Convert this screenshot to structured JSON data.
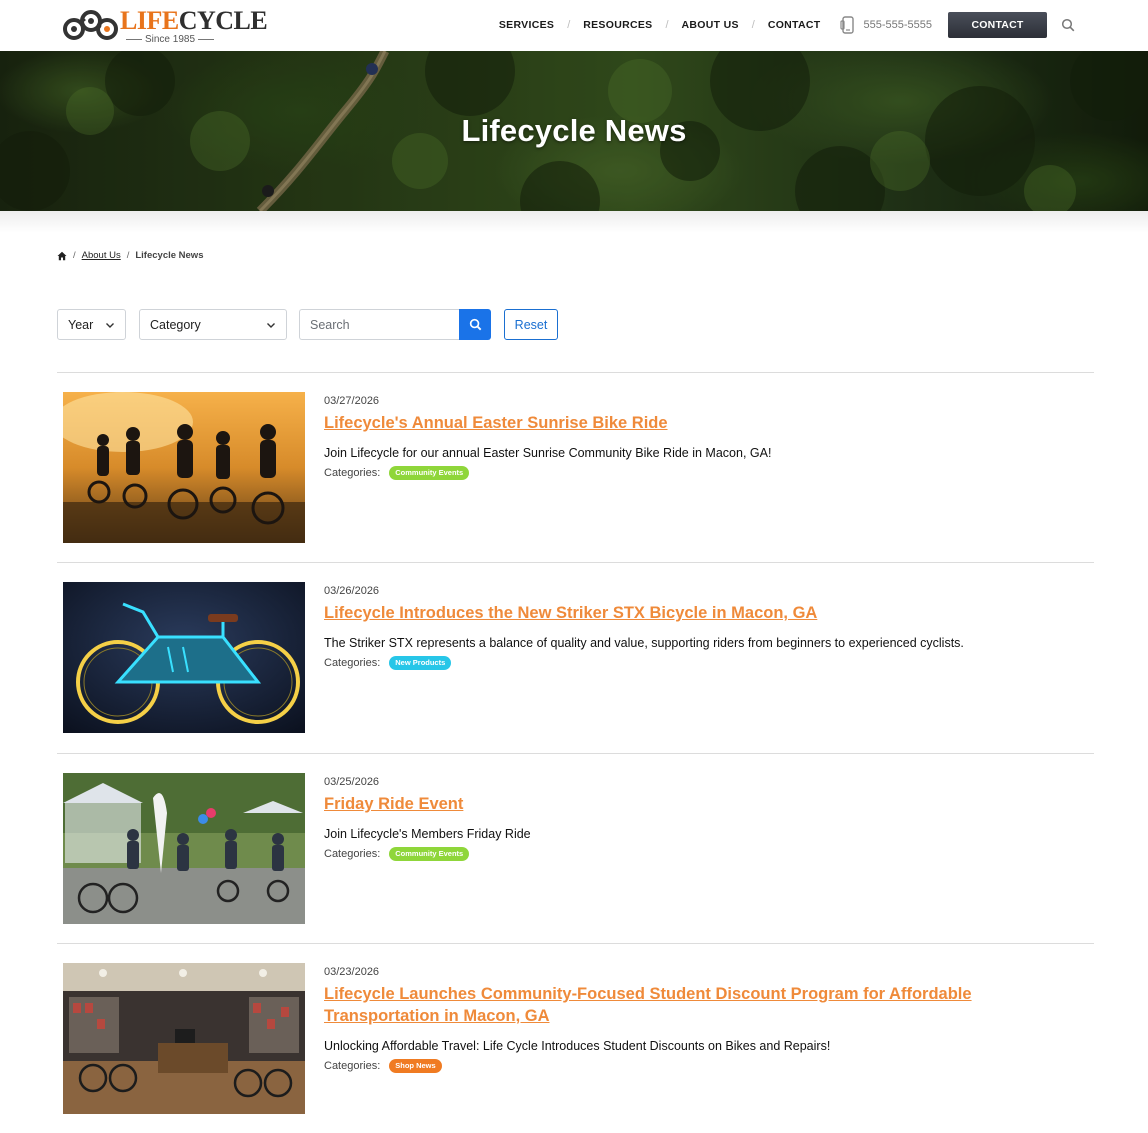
{
  "header": {
    "logo_life": "LIFE",
    "logo_cycle": "CYCLE",
    "logo_since": "Since 1985",
    "nav": [
      "SERVICES",
      "RESOURCES",
      "ABOUT US",
      "CONTACT"
    ],
    "nav_separator": "/",
    "phone": "555-555-5555",
    "contact_button": "CONTACT"
  },
  "hero": {
    "title": "Lifecycle News"
  },
  "breadcrumb": {
    "separator": "/",
    "about": "About Us",
    "current": "Lifecycle News"
  },
  "filters": {
    "year_label": "Year",
    "category_label": "Category",
    "search_placeholder": "Search",
    "reset_label": "Reset"
  },
  "news": [
    {
      "date": "03/27/2026",
      "title": "Lifecycle's Annual Easter Sunrise Bike Ride",
      "excerpt": "Join Lifecycle for our annual Easter Sunrise Community Bike Ride in Macon, GA!",
      "categories_label": "Categories:",
      "category": "Community Events",
      "category_color": "#8fd63a"
    },
    {
      "date": "03/26/2026",
      "title": "Lifecycle Introduces the New Striker STX Bicycle in Macon, GA",
      "excerpt": "The Striker STX represents a balance of quality and value, supporting riders from beginners to experienced cyclists.",
      "categories_label": "Categories:",
      "category": "New Products",
      "category_color": "#27c6e8"
    },
    {
      "date": "03/25/2026",
      "title": "Friday Ride Event",
      "excerpt": "Join Lifecycle's Members Friday Ride",
      "categories_label": "Categories:",
      "category": "Community Events",
      "category_color": "#8fd63a"
    },
    {
      "date": "03/23/2026",
      "title": "Lifecycle Launches Community-Focused Student Discount Program for Affordable Transportation in Macon, GA",
      "excerpt": "Unlocking Affordable Travel: Life Cycle Introduces Student Discounts on Bikes and Repairs!",
      "categories_label": "Categories:",
      "category": "Shop News",
      "category_color": "#f07b22"
    }
  ],
  "colors": {
    "brand_orange": "#e8741c",
    "link_orange": "#ef8a3a",
    "primary_blue": "#1a73e8",
    "contact_button_dark": "#2c2f37"
  }
}
